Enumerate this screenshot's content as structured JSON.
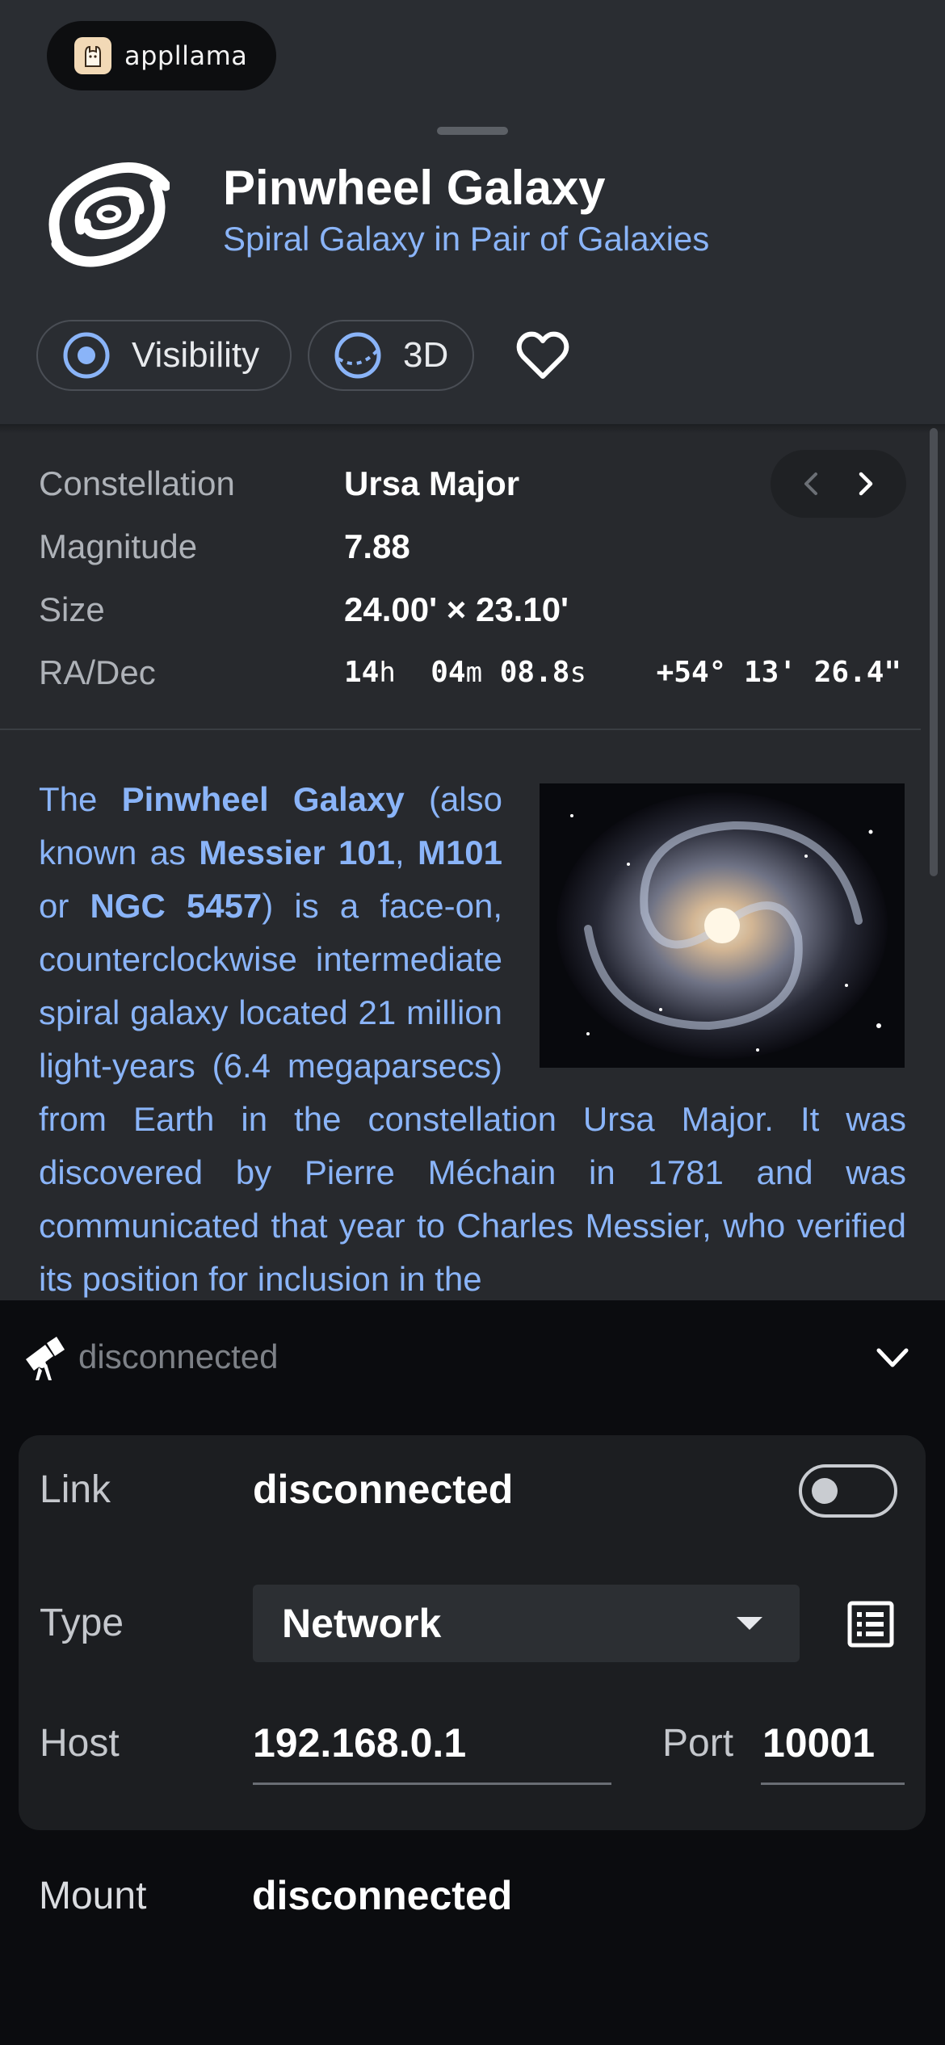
{
  "brand": {
    "name": "appllama"
  },
  "object": {
    "title": "Pinwheel Galaxy",
    "subtitle": "Spiral Galaxy in Pair of Galaxies"
  },
  "chips": {
    "visibility_label": "Visibility",
    "three_d_label": "3D"
  },
  "details": {
    "constellation": {
      "label": "Constellation",
      "value": "Ursa Major"
    },
    "magnitude": {
      "label": "Magnitude",
      "value": "7.88"
    },
    "size": {
      "label": "Size",
      "value": "24.00' × 23.10'"
    },
    "radec": {
      "label": "RA/Dec",
      "ra_h": "14",
      "ra_h_unit": "h",
      "ra_m": "04",
      "ra_m_unit": "m",
      "ra_s": "08.8",
      "ra_s_unit": "s",
      "dec": "+54° 13' 26.4\""
    }
  },
  "description": {
    "t1": "The ",
    "b1": "Pinwheel Galaxy",
    "t2": " (also known as ",
    "b2": "Messier 101",
    "t3": ", ",
    "b3": "M101",
    "t4": " or ",
    "b4": "NGC 5457",
    "t5": ") is a face-on, counterclockwise intermediate spiral galaxy located 21 million light-years (6.4 megaparsecs) from Earth in the constellation Ursa Major. It was discovered by Pierre Méchain in 1781 and was communicated that year to Charles Messier, who verified its position for inclusion in the"
  },
  "telescope": {
    "status": "disconnected",
    "link_label": "Link",
    "link_value": "disconnected",
    "type_label": "Type",
    "type_value": "Network",
    "host_label": "Host",
    "host_value": "192.168.0.1",
    "port_label": "Port",
    "port_value": "10001",
    "mount_label": "Mount",
    "mount_value": "disconnected",
    "link_enabled": false
  },
  "colors": {
    "accent": "#8ab4f8",
    "sheet_bg": "#2a2d32",
    "panel_bg": "#27292d",
    "bottom_bg": "#0b0c0f",
    "card_bg": "#1c1e21"
  },
  "icons": [
    "appllama-logo-icon",
    "galaxy-icon",
    "target-icon",
    "sphere-icon",
    "heart-icon",
    "chevron-left-icon",
    "chevron-right-icon",
    "telescope-icon",
    "chevron-down-icon",
    "list-icon"
  ]
}
